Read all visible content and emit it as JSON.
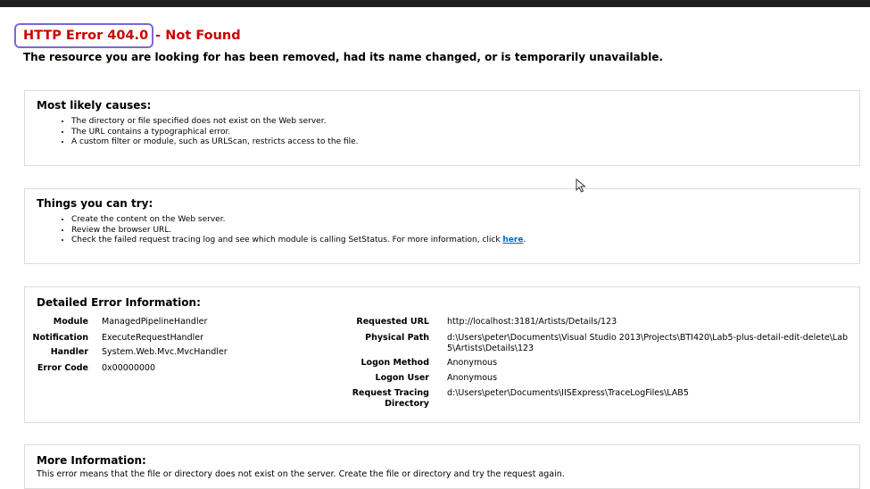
{
  "header": {
    "error_code": "HTTP Error 404.0",
    "error_name": "- Not Found",
    "description": "The resource you are looking for has been removed, had its name changed, or is temporarily unavailable."
  },
  "causes": {
    "title": "Most likely causes:",
    "items": [
      "The directory or file specified does not exist on the Web server.",
      "The URL contains a typographical error.",
      "A custom filter or module, such as URLScan, restricts access to the file."
    ]
  },
  "try": {
    "title": "Things you can try:",
    "items": [
      "Create the content on the Web server.",
      "Review the browser URL."
    ],
    "last_item_text": "Check the failed request tracing log and see which module is calling SetStatus. For more information, click ",
    "last_item_link": "here",
    "last_item_end": "."
  },
  "detail": {
    "title": "Detailed Error Information:",
    "left": [
      {
        "key": "Module",
        "value": "ManagedPipelineHandler"
      },
      {
        "key": "Notification",
        "value": "ExecuteRequestHandler"
      },
      {
        "key": "Handler",
        "value": "System.Web.Mvc.MvcHandler"
      },
      {
        "key": "Error Code",
        "value": "0x00000000"
      }
    ],
    "right": [
      {
        "key": "Requested URL",
        "value": "http://localhost:3181/Artists/Details/123"
      },
      {
        "key": "Physical Path",
        "value": "d:\\Users\\peter\\Documents\\Visual Studio 2013\\Projects\\BTI420\\Lab5-plus-detail-edit-delete\\Lab5\\Artists\\Details\\123"
      },
      {
        "key": "Logon Method",
        "value": "Anonymous"
      },
      {
        "key": "Logon User",
        "value": "Anonymous"
      },
      {
        "key": "Request Tracing Directory",
        "value": "d:\\Users\\peter\\Documents\\IISExpress\\TraceLogFiles\\LAB5"
      }
    ]
  },
  "more": {
    "title": "More Information:",
    "text": "This error means that the file or directory does not exist on the server. Create the file or directory and try the request again."
  }
}
